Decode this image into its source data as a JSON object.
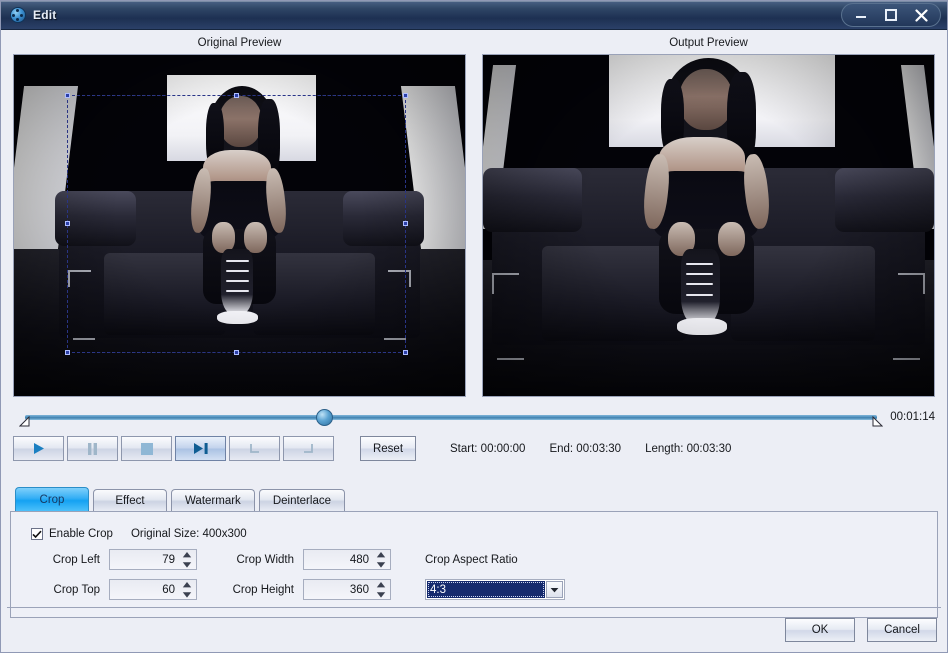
{
  "window": {
    "title": "Edit",
    "icon": "film-reel-icon",
    "controls": {
      "minimize": "minimize-icon",
      "maximize": "maximize-icon",
      "close": "close-icon"
    }
  },
  "previews": {
    "original_label": "Original Preview",
    "output_label": "Output Preview"
  },
  "timeline": {
    "current_time": "00:01:14",
    "position_percent": 36
  },
  "transport": {
    "play": "play-icon",
    "pause": "pause-icon",
    "stop": "stop-icon",
    "next_frame": "next-frame-icon",
    "set_start": "set-start-icon",
    "set_end": "set-end-icon",
    "reset_label": "Reset"
  },
  "trim": {
    "start_label": "Start: 00:00:00",
    "end_label": "End: 00:03:30",
    "length_label": "Length: 00:03:30"
  },
  "tabs": [
    {
      "label": "Crop",
      "active": true
    },
    {
      "label": "Effect",
      "active": false
    },
    {
      "label": "Watermark",
      "active": false
    },
    {
      "label": "Deinterlace",
      "active": false
    }
  ],
  "crop": {
    "enable_label": "Enable Crop",
    "enabled": true,
    "original_size_label": "Original Size: 400x300",
    "fields": [
      {
        "label": "Crop Left",
        "value": "79"
      },
      {
        "label": "Crop Width",
        "value": "480"
      },
      {
        "label": "Crop Top",
        "value": "60"
      },
      {
        "label": "Crop Height",
        "value": "360"
      }
    ],
    "aspect_ratio_label": "Crop Aspect Ratio",
    "aspect_ratio_value": "4:3"
  },
  "footer": {
    "ok_label": "OK",
    "cancel_label": "Cancel"
  },
  "colors": {
    "titlebar": "#1d3052",
    "active_tab": "#14a2f2",
    "selection": "#152a6e",
    "panel_bg": "#eef0f7",
    "crop_outline": "#8fa8ff"
  }
}
